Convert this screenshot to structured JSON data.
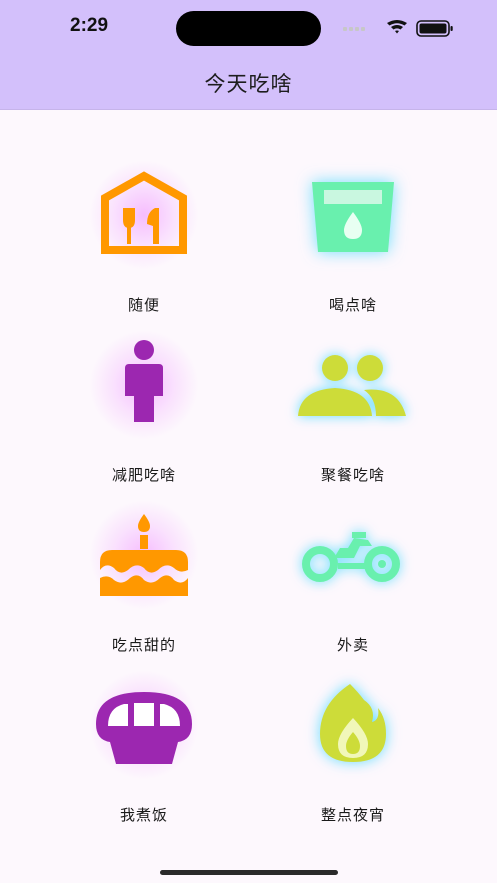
{
  "status": {
    "time": "2:29"
  },
  "nav": {
    "title": "今天吃啥"
  },
  "tiles": [
    {
      "label": "随便",
      "icon": "restaurant-house-icon",
      "color": "#ff9800"
    },
    {
      "label": "喝点啥",
      "icon": "drink-cup-icon",
      "color": "#69f0ae"
    },
    {
      "label": "减肥吃啥",
      "icon": "person-icon",
      "color": "#9c27b0"
    },
    {
      "label": "聚餐吃啥",
      "icon": "group-people-icon",
      "color": "#cddc39"
    },
    {
      "label": "吃点甜的",
      "icon": "birthday-cake-icon",
      "color": "#ff9800"
    },
    {
      "label": "外卖",
      "icon": "delivery-bike-icon",
      "color": "#69f0ae"
    },
    {
      "label": "我煮饭",
      "icon": "rice-cooker-icon",
      "color": "#9c27b0"
    },
    {
      "label": "整点夜宵",
      "icon": "flame-icon",
      "color": "#cddc39"
    }
  ],
  "colors": {
    "header": "#d3c0fb",
    "background": "#fdf8fd",
    "pink_glow": "#f08cff",
    "cyan_glow": "#4fd8ff"
  }
}
